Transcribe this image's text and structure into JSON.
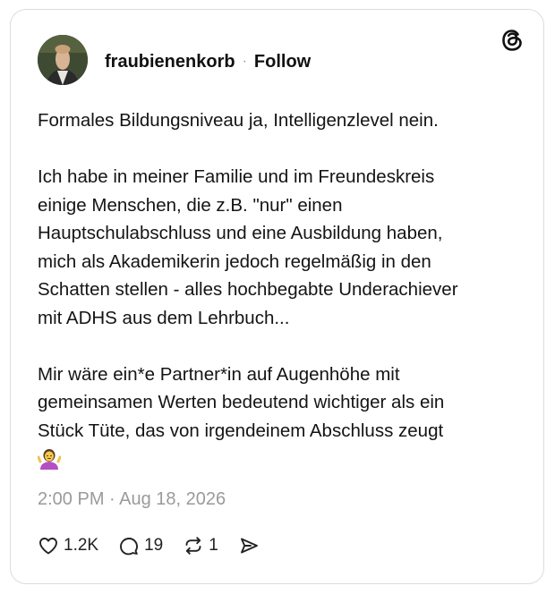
{
  "post": {
    "username": "fraubienenkorb",
    "separator": "·",
    "follow_label": "Follow",
    "paragraphs": [
      "Formales Bildungsniveau ja, Intelligenzlevel nein.",
      "Ich habe in meiner Familie und im Freundeskreis\neinige Menschen, die z.B. \"nur\" einen\nHauptschulabschluss und eine Ausbildung haben,\nmich als Akademikerin jedoch regelmäßig in den\nSchatten stellen - alles hochbegabte Underachiever\nmit ADHS  aus dem Lehrbuch...",
      "Mir wäre ein*e Partner*in auf Augenhöhe mit\ngemeinsamen Werten bedeutend wichtiger als ein\nStück Tüte, das von irgendeinem Abschluss zeugt"
    ],
    "emoji": "woman-shrugging-emoji",
    "timestamp": "2:00 PM · Aug 18, 2026"
  },
  "actions": {
    "likes": "1.2K",
    "replies": "19",
    "reposts": "1"
  },
  "icons": {
    "logo": "threads-logo-icon",
    "like": "heart-icon",
    "reply": "comment-bubble-icon",
    "repost": "repost-icon",
    "share": "send-icon"
  },
  "colors": {
    "text": "#141414",
    "muted": "#9a9a9a",
    "border": "#dcdcdc",
    "emoji_shirt": "#b44ec4"
  }
}
